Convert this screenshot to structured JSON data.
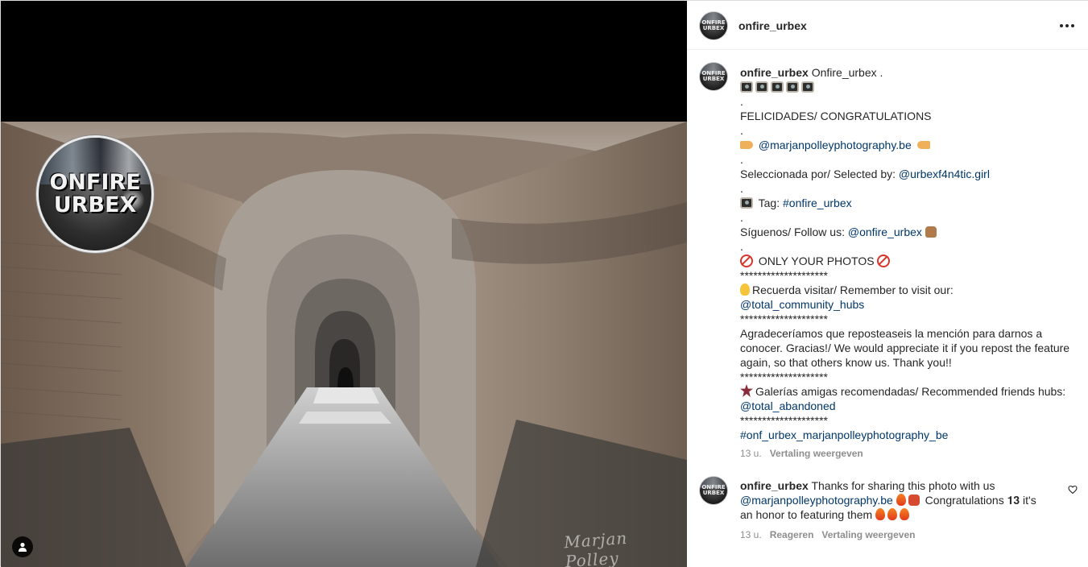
{
  "post": {
    "author": "onfire_urbex",
    "photo": {
      "logo_line1": "ONFIRE",
      "logo_line2": "URBEX",
      "signature": "Marjan Polley"
    }
  },
  "header": {
    "username": "onfire_urbex",
    "avatar_text1": "ONFIRE",
    "avatar_text2": "URBEX",
    "more_icon": "more-horizontal-icon"
  },
  "caption": {
    "username": "onfire_urbex",
    "intro": "Onfire_urbex .",
    "dot": ".",
    "congrats": "FELICIDADES/ CONGRATULATIONS",
    "featured_user": "@marjanpolleyphotography.be",
    "selected_by_label": "Seleccionada por/ Selected by: ",
    "selected_by_user": "@urbexf4n4tic.girl",
    "tag_label": "Tag: ",
    "tag": "#onfire_urbex",
    "follow_label": "Síguenos/ Follow us: ",
    "follow_user": "@onfire_urbex",
    "only_photos": "ONLY YOUR PHOTOS",
    "stars": "********************",
    "remember_label": "Recuerda visitar/ Remember to visit our:",
    "community_hubs": "@total_community_hubs",
    "repost_text": "Agradeceríamos que reposteaseis la mención para darnos a conocer. Gracias!/ We would appreciate it if you repost the feature again, so that others know us. Thank you!!",
    "friends_label": "Galerías amigas recomendadas/ Recommended friends hubs:",
    "friends_hub": "@total_abandoned",
    "final_tag": "#onf_urbex_marjanpolleyphotography_be",
    "time": "13 u.",
    "see_translation": "Vertaling weergeven"
  },
  "comment": {
    "username": "onfire_urbex",
    "text1": "Thanks for sharing this photo with us",
    "mention": "@marjanpolleyphotography.be",
    "text2": "Congratulations 𝟏𝟑 it's",
    "text3": "an honor to featuring them",
    "time": "13 u.",
    "reply": "Reageren",
    "see_translation": "Vertaling weergeven"
  }
}
